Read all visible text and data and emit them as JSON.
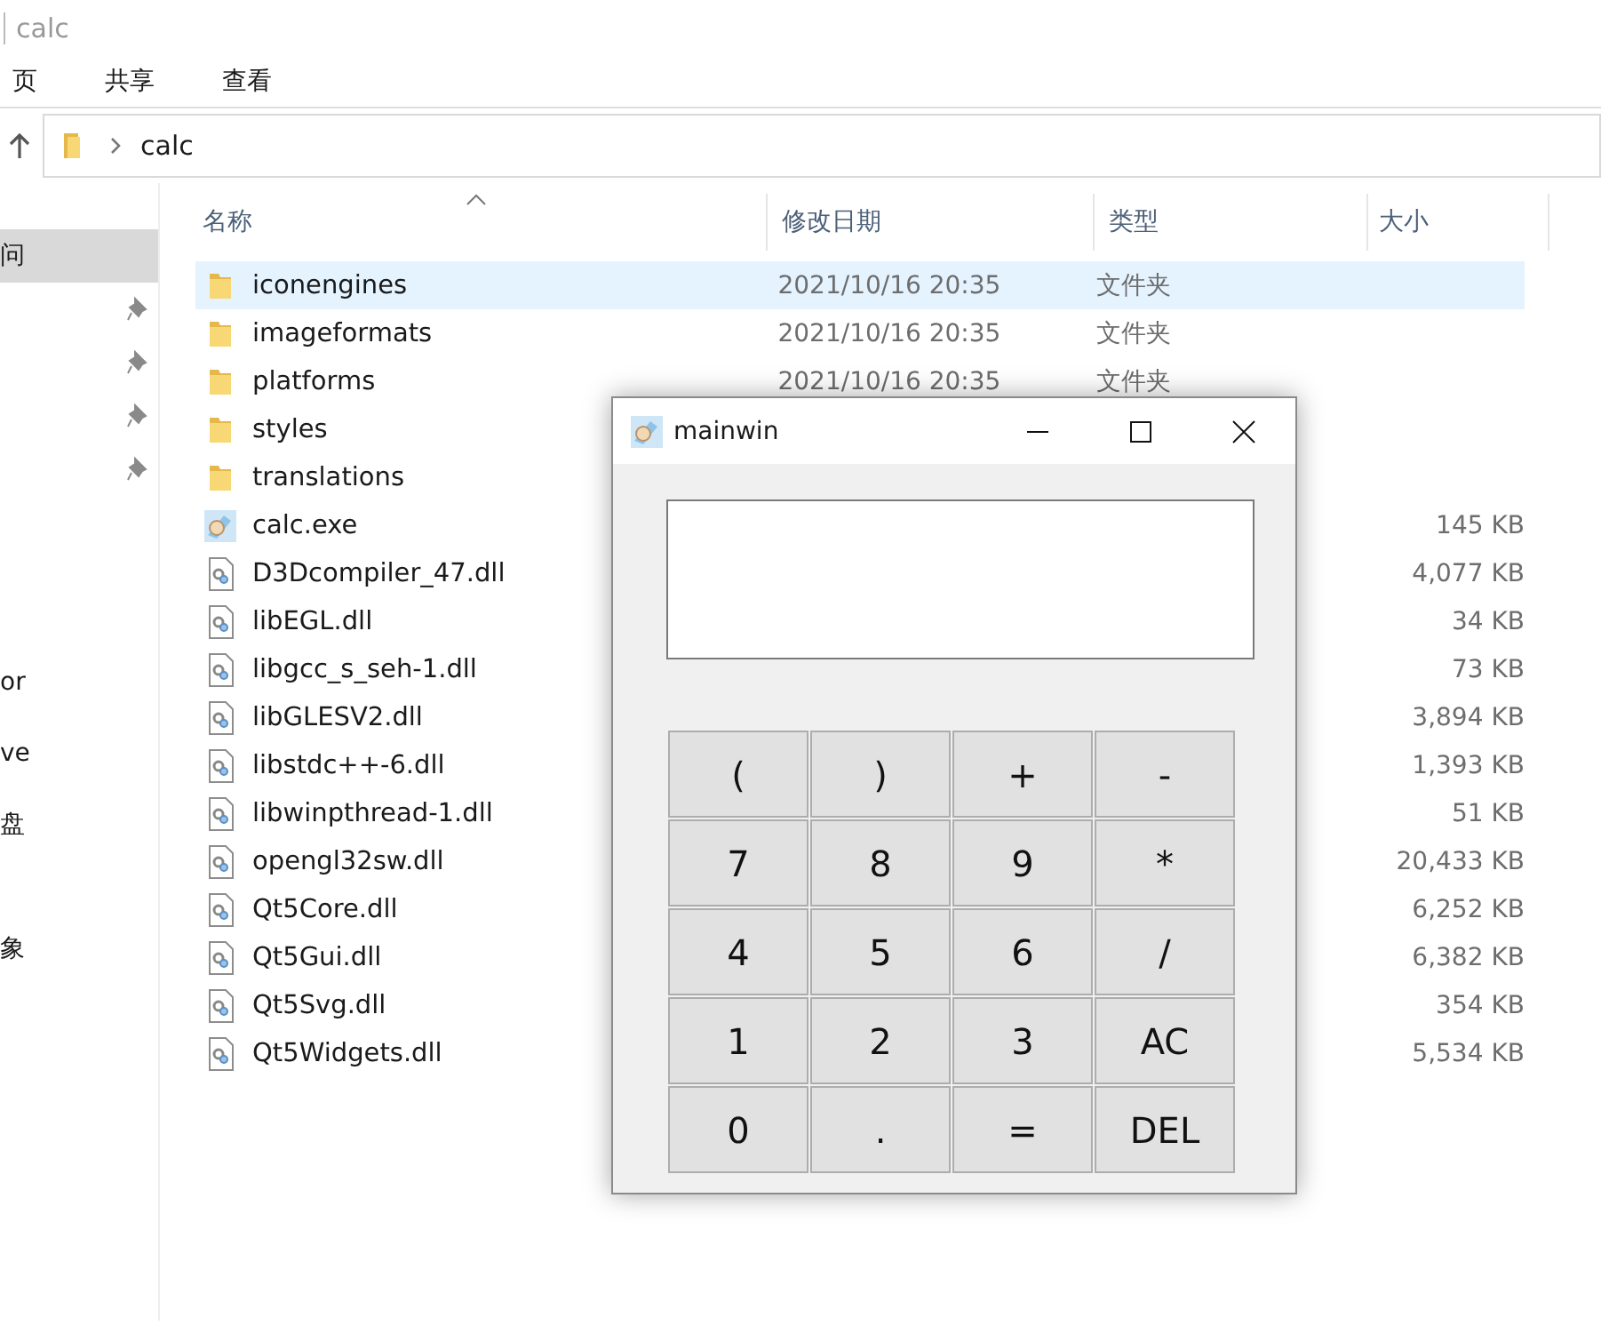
{
  "window": {
    "title": "calc"
  },
  "ribbon": {
    "tabs": [
      {
        "label": "页",
        "selected": false
      },
      {
        "label": "共享",
        "selected": false
      },
      {
        "label": "查看",
        "selected": false
      }
    ]
  },
  "address": {
    "path": "calc"
  },
  "nav": {
    "groups": [
      [
        {
          "label": "问",
          "selected": true,
          "pinned": false
        },
        {
          "selected": false,
          "pinned": true
        },
        {
          "selected": false,
          "pinned": true
        },
        {
          "selected": false,
          "pinned": true
        },
        {
          "selected": false,
          "pinned": true
        }
      ],
      [
        {
          "label": "or",
          "selected": false,
          "pinned": false
        }
      ],
      [
        {
          "label": "ve",
          "selected": false,
          "pinned": false
        }
      ],
      [
        {
          "label": "盘",
          "selected": false,
          "pinned": false
        }
      ],
      [
        {
          "label": "象",
          "selected": false,
          "pinned": false
        }
      ]
    ]
  },
  "table": {
    "columns": [
      "名称",
      "修改日期",
      "类型",
      "大小"
    ],
    "rows": [
      {
        "kind": "folder",
        "name": "iconengines",
        "date": "2021/10/16 20:35",
        "type": "文件夹",
        "size": "",
        "selected": true
      },
      {
        "kind": "folder",
        "name": "imageformats",
        "date": "2021/10/16 20:35",
        "type": "文件夹",
        "size": "",
        "selected": false
      },
      {
        "kind": "folder",
        "name": "platforms",
        "date": "2021/10/16 20:35",
        "type": "文件夹",
        "size": "",
        "selected": false
      },
      {
        "kind": "folder",
        "name": "styles",
        "date": "",
        "type": "",
        "size": "",
        "selected": false
      },
      {
        "kind": "folder",
        "name": "translations",
        "date": "",
        "type": "",
        "size": "",
        "selected": false
      },
      {
        "kind": "exe",
        "name": "calc.exe",
        "date": "",
        "type": "",
        "size": "145 KB",
        "selected": false
      },
      {
        "kind": "dll",
        "name": "D3Dcompiler_47.dll",
        "date": "",
        "type": "",
        "size": "4,077 KB",
        "selected": false
      },
      {
        "kind": "dll",
        "name": "libEGL.dll",
        "date": "",
        "type": "",
        "size": "34 KB",
        "selected": false
      },
      {
        "kind": "dll",
        "name": "libgcc_s_seh-1.dll",
        "date": "",
        "type": "",
        "size": "73 KB",
        "selected": false
      },
      {
        "kind": "dll",
        "name": "libGLESV2.dll",
        "date": "",
        "type": "",
        "size": "3,894 KB",
        "selected": false
      },
      {
        "kind": "dll",
        "name": "libstdc++-6.dll",
        "date": "",
        "type": "",
        "size": "1,393 KB",
        "selected": false
      },
      {
        "kind": "dll",
        "name": "libwinpthread-1.dll",
        "date": "",
        "type": "",
        "size": "51 KB",
        "selected": false
      },
      {
        "kind": "dll",
        "name": "opengl32sw.dll",
        "date": "",
        "type": "",
        "size": "20,433 KB",
        "selected": false
      },
      {
        "kind": "dll",
        "name": "Qt5Core.dll",
        "date": "",
        "type": "",
        "size": "6,252 KB",
        "selected": false
      },
      {
        "kind": "dll",
        "name": "Qt5Gui.dll",
        "date": "",
        "type": "",
        "size": "6,382 KB",
        "selected": false
      },
      {
        "kind": "dll",
        "name": "Qt5Svg.dll",
        "date": "",
        "type": "",
        "size": "354 KB",
        "selected": false
      },
      {
        "kind": "dll",
        "name": "Qt5Widgets.dll",
        "date": "",
        "type": "",
        "size": "5,534 KB",
        "selected": false
      }
    ]
  },
  "calculator": {
    "title": "mainwin",
    "keys": [
      [
        "(",
        ")",
        "+",
        "-"
      ],
      [
        "7",
        "8",
        "9",
        "*"
      ],
      [
        "4",
        "5",
        "6",
        "/"
      ],
      [
        "1",
        "2",
        "3",
        "AC"
      ],
      [
        "0",
        ".",
        "=",
        "DEL"
      ]
    ]
  }
}
